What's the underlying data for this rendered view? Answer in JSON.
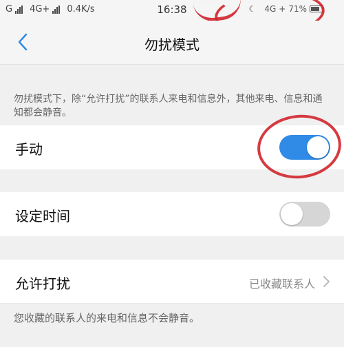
{
  "status_bar": {
    "carrier_left": "G",
    "network_1": "4G+",
    "speed": "0.4K/s",
    "time": "16:38",
    "network_2": "4G",
    "network_2_plus": "+",
    "battery_text": "71%"
  },
  "nav": {
    "back_icon": "chevron-left-icon",
    "title": "勿扰模式"
  },
  "description": "勿扰模式下，除“允许打扰”的联系人来电和信息外，其他来电、信息和通知都会静音。",
  "settings": {
    "manual": {
      "label": "手动",
      "enabled": true
    },
    "scheduled": {
      "label": "设定时间",
      "enabled": false
    },
    "allow": {
      "label": "允许打扰",
      "value": "已收藏联系人"
    }
  },
  "note": "您收藏的联系人的来电和信息不会静音。",
  "colors": {
    "toggle_on": "#2f8be6",
    "toggle_off": "#d6d6d6",
    "annotation_red": "#d0262c",
    "accent_back": "#2f8be6"
  }
}
